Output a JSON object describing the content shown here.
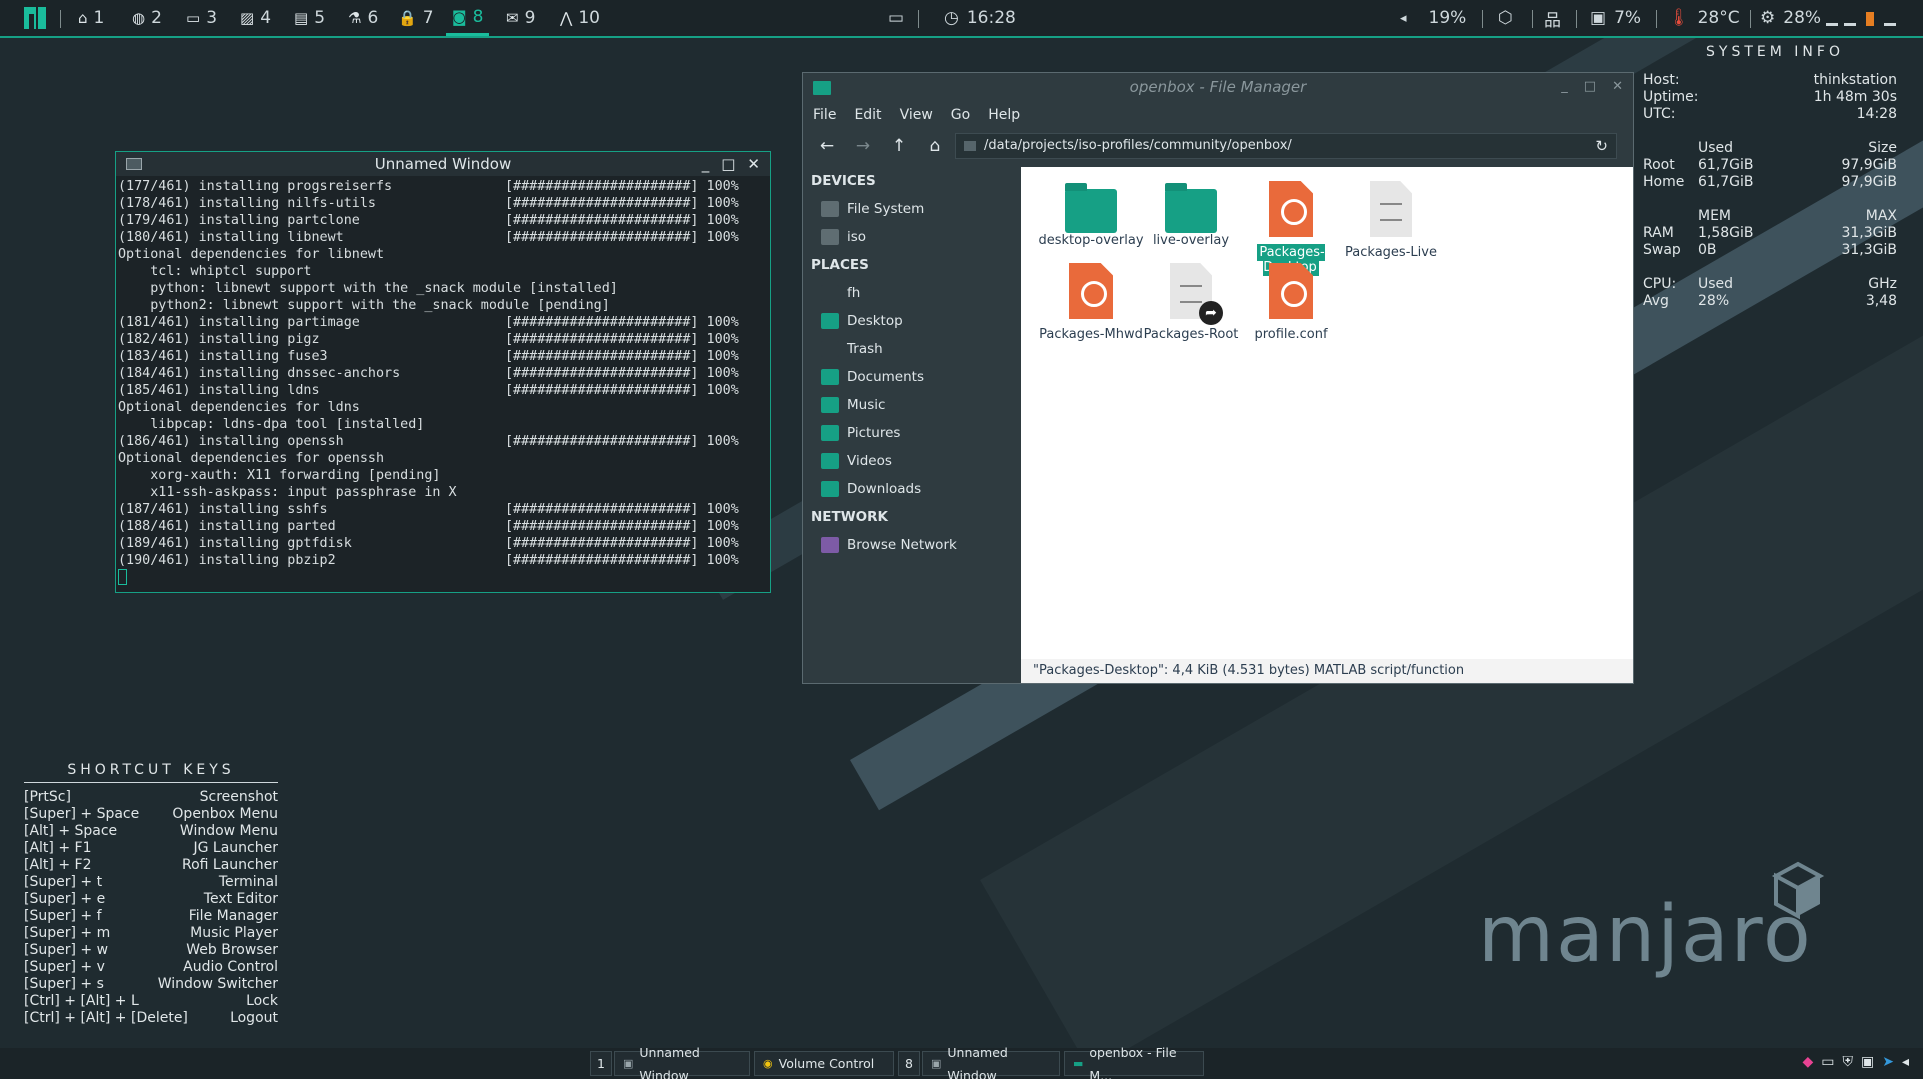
{
  "topbar": {
    "workspaces": [
      {
        "num": "1",
        "icon": "home-icon"
      },
      {
        "num": "2",
        "icon": "globe-icon"
      },
      {
        "num": "3",
        "icon": "folder-icon"
      },
      {
        "num": "4",
        "icon": "image-icon"
      },
      {
        "num": "5",
        "icon": "document-icon"
      },
      {
        "num": "6",
        "icon": "flask-icon"
      },
      {
        "num": "7",
        "icon": "lock-icon"
      },
      {
        "num": "8",
        "icon": "camera-icon"
      },
      {
        "num": "9",
        "icon": "mail-icon"
      },
      {
        "num": "10",
        "icon": "arrow-up-icon"
      }
    ],
    "active_workspace": "8",
    "clock": "16:28",
    "volume": "19%",
    "cpu": "7%",
    "temperature": "28°C",
    "brightness": "28%",
    "accent": "#1abc9c"
  },
  "sysinfo": {
    "title": "SYSTEM INFO",
    "host_label": "Host:",
    "host": "thinkstation",
    "uptime_label": "Uptime:",
    "uptime": "1h 48m 30s",
    "utc_label": "UTC:",
    "utc": "14:28",
    "disk_used_h": "Used",
    "disk_size_h": "Size",
    "root_label": "Root",
    "root_used": "61,7GiB",
    "root_size": "97,9GiB",
    "home_label": "Home",
    "home_used": "61,7GiB",
    "home_size": "97,9GiB",
    "mem_h": "MEM",
    "max_h": "MAX",
    "ram_label": "RAM",
    "ram_used": "1,58GiB",
    "ram_max": "31,3GiB",
    "swap_label": "Swap",
    "swap_used": "0B",
    "swap_max": "31,3GiB",
    "cpu_label": "CPU:",
    "cpu_used_h": "Used",
    "ghz_h": "GHz",
    "avg_label": "Avg",
    "avg_used": "28%",
    "avg_ghz": "3,48"
  },
  "shortcuts": {
    "title": "SHORTCUT KEYS",
    "items": [
      {
        "key": "[PrtSc]",
        "action": "Screenshot"
      },
      {
        "key": "[Super] + Space",
        "action": "Openbox Menu"
      },
      {
        "key": "[Alt] + Space",
        "action": "Window Menu"
      },
      {
        "key": "[Alt] + F1",
        "action": "JG Launcher"
      },
      {
        "key": "[Alt] + F2",
        "action": "Rofi Launcher"
      },
      {
        "key": "[Super] + t",
        "action": "Terminal"
      },
      {
        "key": "[Super] + e",
        "action": "Text Editor"
      },
      {
        "key": "[Super] + f",
        "action": "File Manager"
      },
      {
        "key": "[Super] + m",
        "action": "Music Player"
      },
      {
        "key": "[Super] + w",
        "action": "Web Browser"
      },
      {
        "key": "[Super] + v",
        "action": "Audio Control"
      },
      {
        "key": "[Super] + s",
        "action": "Window Switcher"
      },
      {
        "key": "[Ctrl] + [Alt] + L",
        "action": "Lock"
      },
      {
        "key": "[Ctrl] + [Alt] + [Delete]",
        "action": "Logout"
      }
    ]
  },
  "terminal": {
    "title": "Unnamed Window",
    "lines": [
      "(177/461) installing progsreiserfs              [######################] 100%",
      "(178/461) installing nilfs-utils                [######################] 100%",
      "(179/461) installing partclone                  [######################] 100%",
      "(180/461) installing libnewt                    [######################] 100%",
      "Optional dependencies for libnewt",
      "    tcl: whiptcl support",
      "    python: libnewt support with the _snack module [installed]",
      "    python2: libnewt support with the _snack module [pending]",
      "(181/461) installing partimage                  [######################] 100%",
      "(182/461) installing pigz                       [######################] 100%",
      "(183/461) installing fuse3                      [######################] 100%",
      "(184/461) installing dnssec-anchors             [######################] 100%",
      "(185/461) installing ldns                       [######################] 100%",
      "Optional dependencies for ldns",
      "    libpcap: ldns-dpa tool [installed]",
      "(186/461) installing openssh                    [######################] 100%",
      "Optional dependencies for openssh",
      "    xorg-xauth: X11 forwarding [pending]",
      "    x11-ssh-askpass: input passphrase in X",
      "(187/461) installing sshfs                      [######################] 100%",
      "(188/461) installing parted                     [######################] 100%",
      "(189/461) installing gptfdisk                   [######################] 100%",
      "(190/461) installing pbzip2                     [######################] 100%"
    ]
  },
  "filemanager": {
    "title": "openbox - File Manager",
    "menu": [
      "File",
      "Edit",
      "View",
      "Go",
      "Help"
    ],
    "path": "/data/projects/iso-profiles/community/openbox/",
    "sections": {
      "devices": "DEVICES",
      "places": "PLACES",
      "network": "NETWORK"
    },
    "devices": [
      "File System",
      "iso"
    ],
    "places": [
      "fh",
      "Desktop",
      "Trash",
      "Documents",
      "Music",
      "Pictures",
      "Videos",
      "Downloads"
    ],
    "network": [
      "Browse Network"
    ],
    "files": [
      {
        "name": "desktop-overlay",
        "type": "folder"
      },
      {
        "name": "live-overlay",
        "type": "folder"
      },
      {
        "name": "Packages-Desktop",
        "type": "package",
        "selected": true
      },
      {
        "name": "Packages-Live",
        "type": "doc"
      },
      {
        "name": "Packages-Mhwd",
        "type": "package"
      },
      {
        "name": "Packages-Root",
        "type": "link"
      },
      {
        "name": "profile.conf",
        "type": "package"
      }
    ],
    "status": "\"Packages-Desktop\": 4,4 KiB (4.531 bytes) MATLAB script/function"
  },
  "brand": "manjaro",
  "taskbar": {
    "tasks": [
      {
        "label": "1",
        "kind": "num"
      },
      {
        "label": "Unnamed Window",
        "kind": "window"
      },
      {
        "label": "Volume Control",
        "kind": "window"
      },
      {
        "label": "8",
        "kind": "num"
      },
      {
        "label": "Unnamed Window",
        "kind": "window"
      },
      {
        "label": "openbox - File M...",
        "kind": "window"
      }
    ]
  }
}
